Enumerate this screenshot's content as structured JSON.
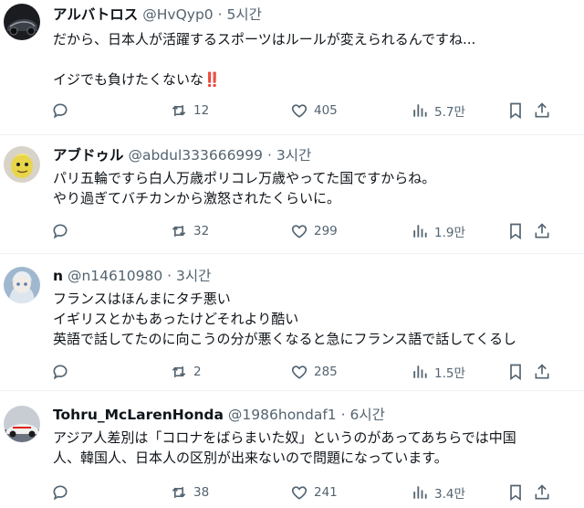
{
  "tweets": [
    {
      "name": "アルバトロス",
      "handle": "@HvQyp0",
      "sep": "·",
      "time": "5시간",
      "body": "だから、日本人が活躍するスポーツはルールが変えられるんですね...\n\nイジでも負けたくないな‼️",
      "replies": "",
      "retweets": "12",
      "likes": "405",
      "views": "5.7만"
    },
    {
      "name": "アブドゥル",
      "handle": "@abdul333666999",
      "sep": "·",
      "time": "3시간",
      "body": "パリ五輪ですら白人万歳ポリコレ万歳やってた国ですからね。\nやり過ぎてバチカンから激怒されたくらいに。",
      "replies": "",
      "retweets": "32",
      "likes": "299",
      "views": "1.9만"
    },
    {
      "name": "n",
      "handle": "@n14610980",
      "sep": "·",
      "time": "3시간",
      "body": "フランスはほんまにタチ悪い\nイギリスとかもあったけどそれより酷い\n英語で話してたのに向こうの分が悪くなると急にフランス語で話してくるし",
      "replies": "",
      "retweets": "2",
      "likes": "285",
      "views": "1.5만"
    },
    {
      "name": "Tohru_McLarenHonda",
      "handle": "@1986hondaf1",
      "sep": "·",
      "time": "6시간",
      "body": "アジア人差別は「コロナをばらまいた奴」というのがあってあちらでは中国\n人、韓国人、日本人の区別が出来ないので問題になっています。",
      "replies": "",
      "retweets": "38",
      "likes": "241",
      "views": "3.4만"
    }
  ],
  "icons": {
    "reply": "reply-icon",
    "retweet": "retweet-icon",
    "like": "heart-icon",
    "views": "views-icon",
    "bookmark": "bookmark-icon",
    "share": "share-icon"
  },
  "colors": {
    "text": "#0f1419",
    "muted": "#536471",
    "divider": "#eff3f4"
  }
}
